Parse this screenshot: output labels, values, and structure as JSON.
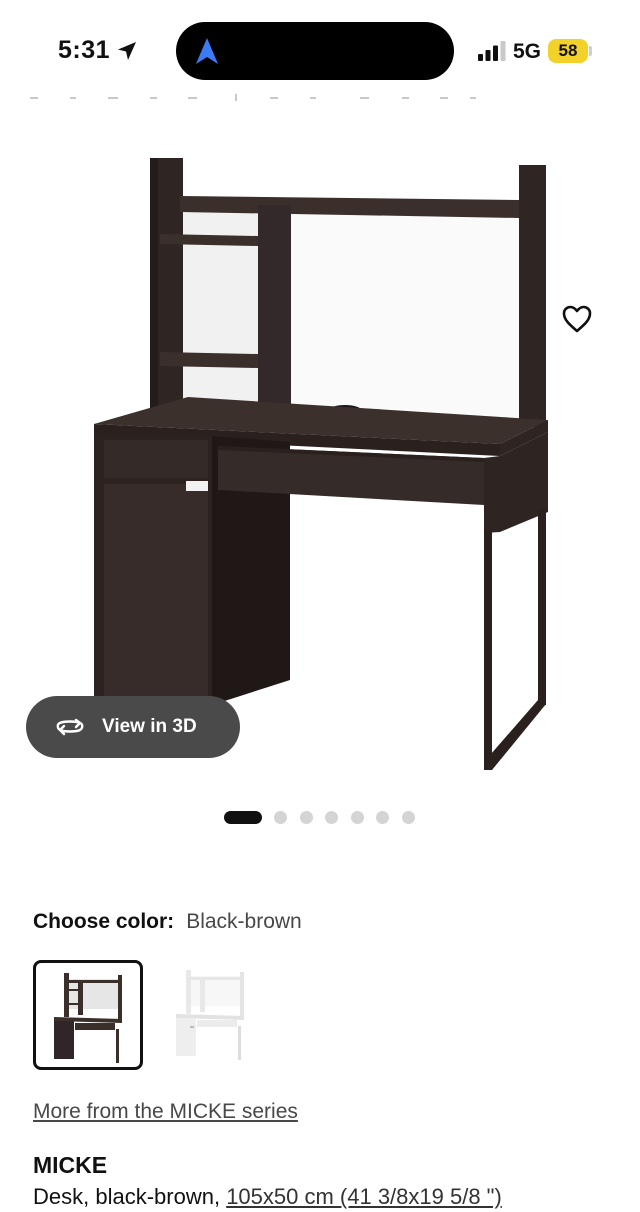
{
  "status_bar": {
    "time": "5:31",
    "network": "5G",
    "battery": "58",
    "battery_color": "#f2d22a"
  },
  "hero": {
    "view_3d_label": "View in 3D",
    "image_count": 7,
    "active_image_index": 0
  },
  "color": {
    "label": "Choose color:",
    "selected": "Black-brown",
    "options": [
      {
        "name": "black-brown",
        "hex": "#3a2f2b",
        "selected": true
      },
      {
        "name": "white",
        "hex": "#ffffff",
        "selected": false
      }
    ]
  },
  "series_link": "More from the MICKE series",
  "product": {
    "name": "MICKE",
    "description": "Desk, black-brown, ",
    "dimensions": "105x50 cm (41 3/8x19 5/8 \")"
  },
  "icons": [
    "location-arrow-icon",
    "navigation-icon",
    "signal-icon",
    "heart-icon",
    "rotate-3d-icon"
  ]
}
